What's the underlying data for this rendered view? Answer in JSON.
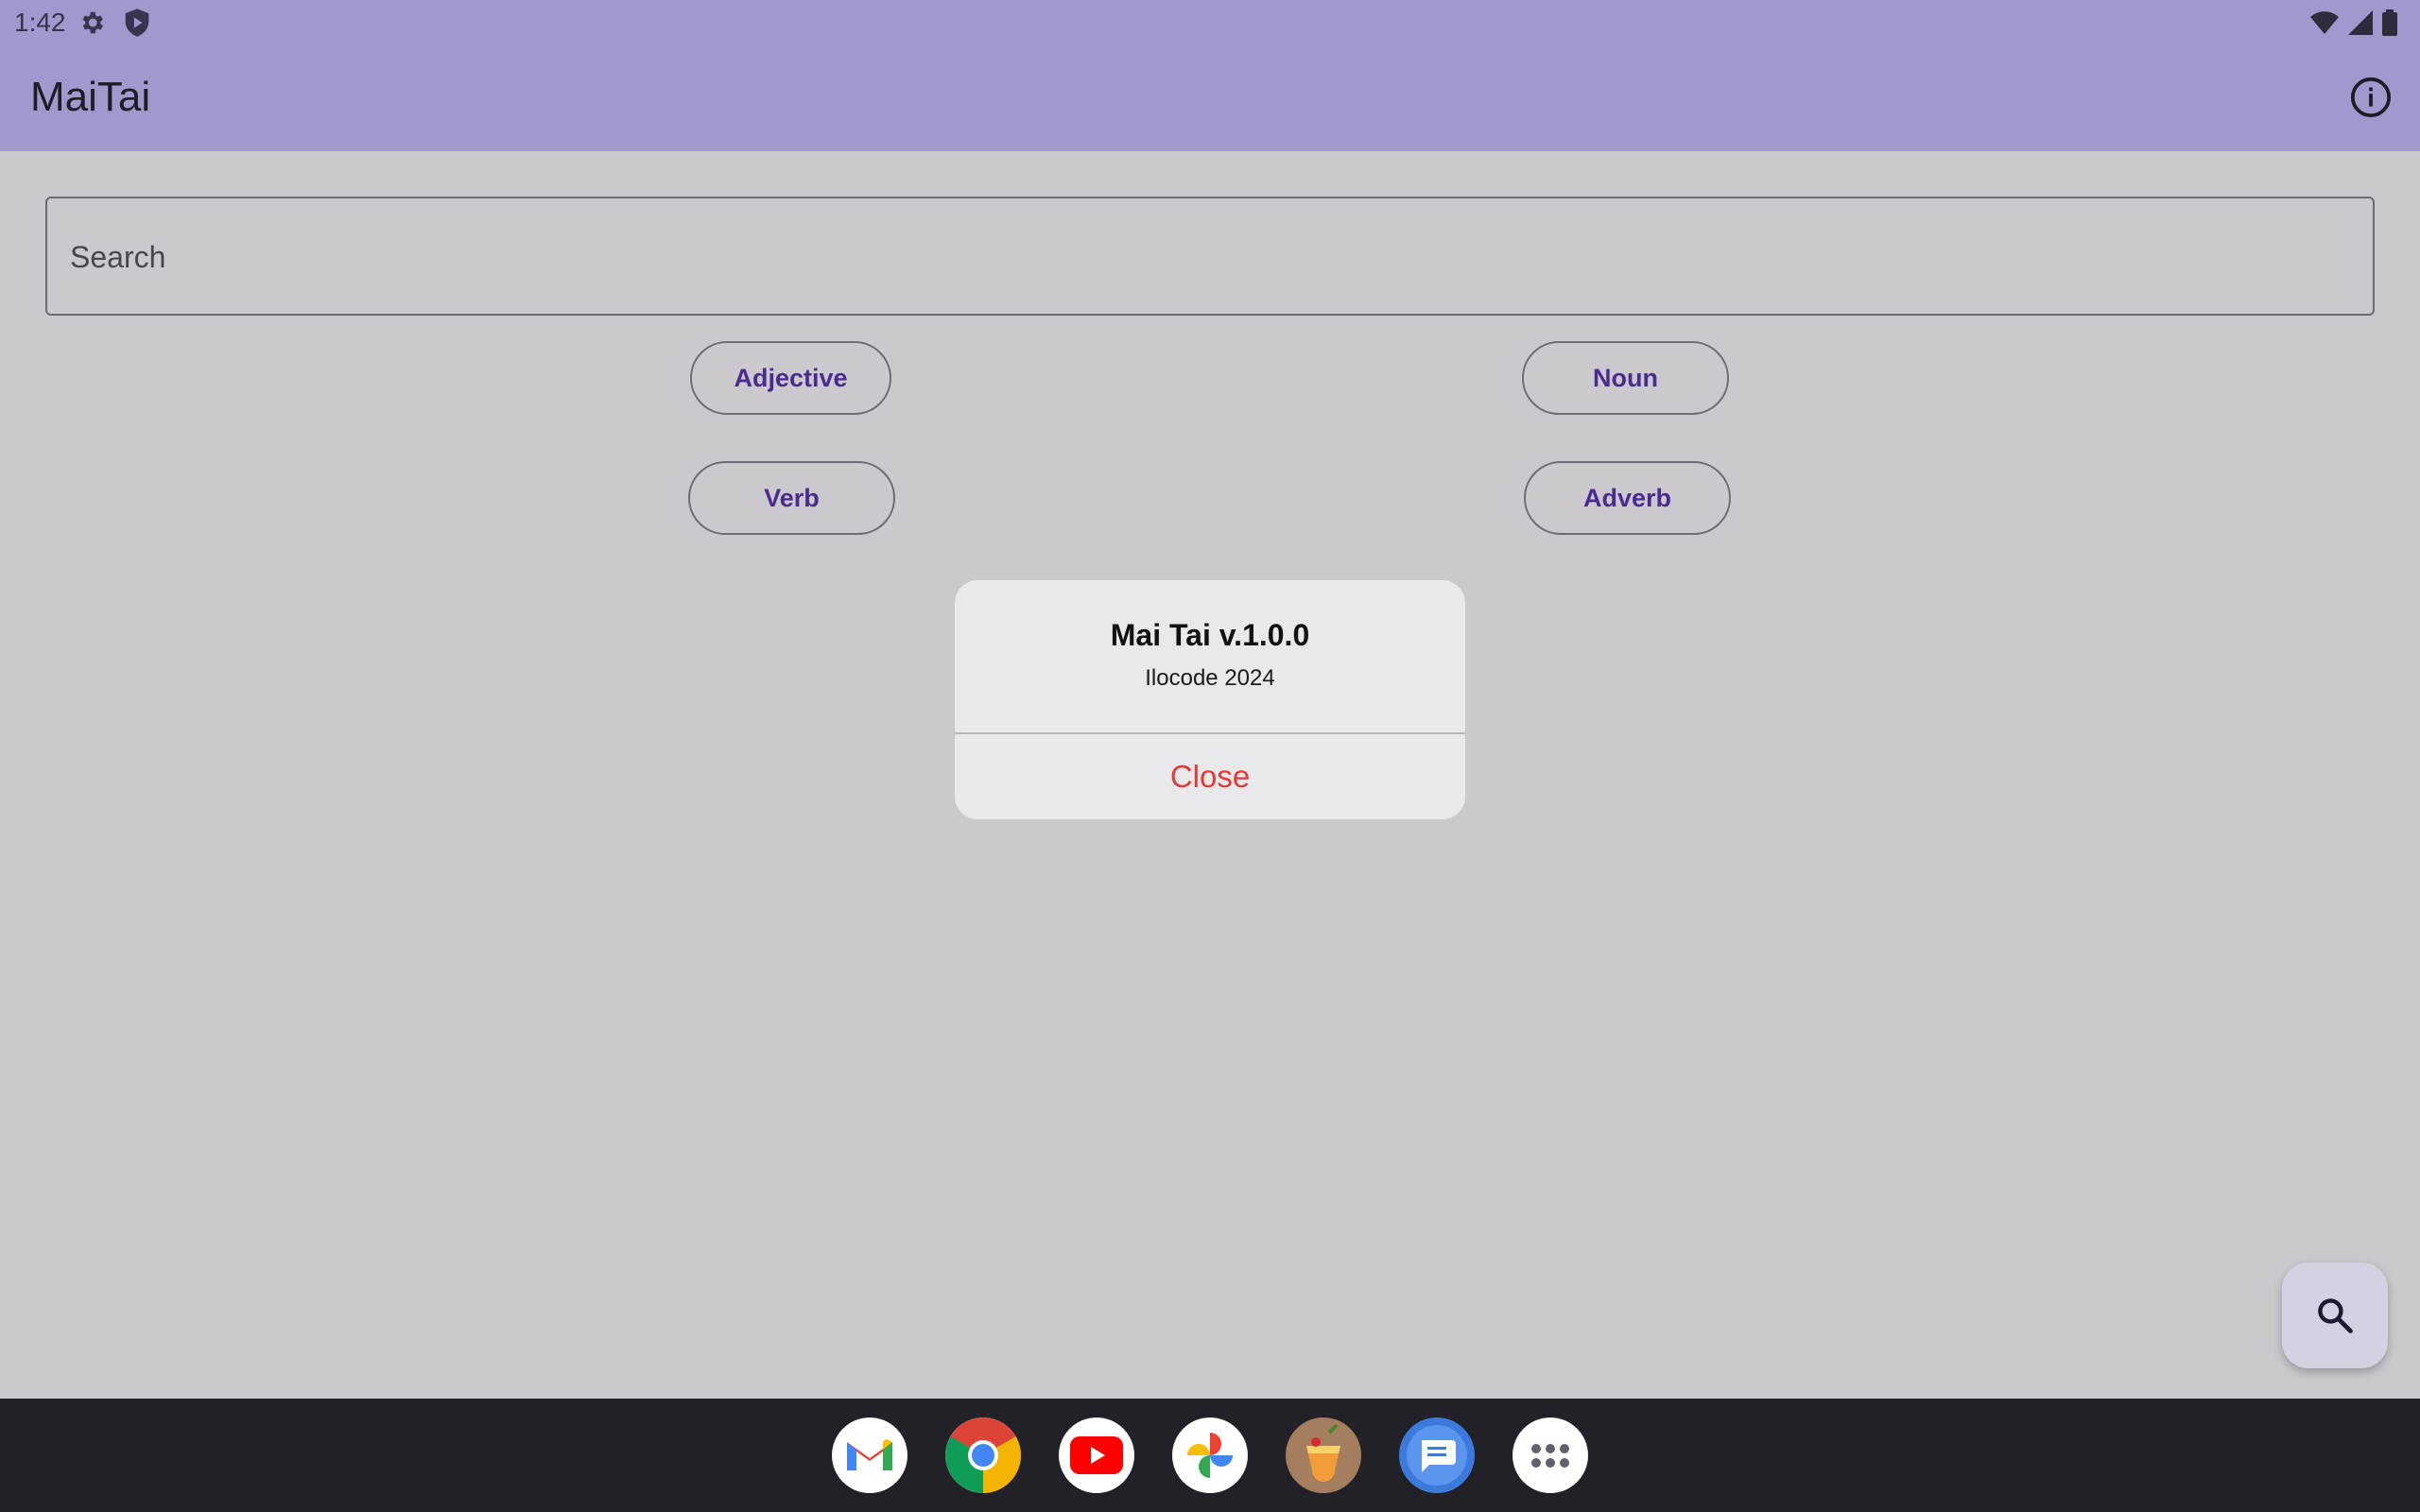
{
  "status_bar": {
    "time": "1:42",
    "icons_left": [
      "gear-icon",
      "shield-play-icon"
    ],
    "icons_right": [
      "wifi-icon",
      "cell-signal-icon",
      "battery-icon"
    ]
  },
  "app_bar": {
    "title": "MaiTai",
    "info_icon": "info-icon",
    "color": "#a398cd"
  },
  "search": {
    "placeholder": "Search",
    "value": ""
  },
  "chips": [
    {
      "label": "Adjective"
    },
    {
      "label": "Noun"
    },
    {
      "label": "Verb"
    },
    {
      "label": "Adverb"
    }
  ],
  "dialog": {
    "title": "Mai Tai v.1.0.0",
    "subtitle": "Ilocode 2024",
    "close_label": "Close",
    "close_color": "#e53935"
  },
  "fab": {
    "icon": "search-icon"
  },
  "dock": {
    "apps": [
      "gmail-icon",
      "chrome-icon",
      "youtube-icon",
      "photos-icon",
      "maitai-app-icon",
      "messages-icon",
      "app-drawer-icon"
    ]
  }
}
